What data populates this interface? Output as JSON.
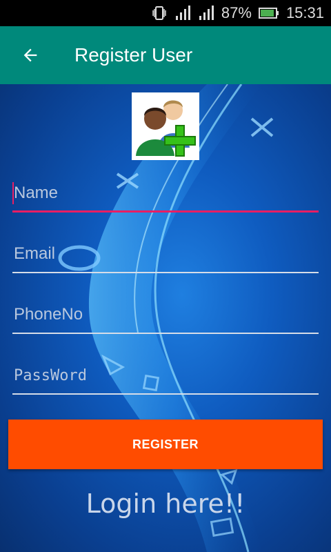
{
  "status_bar": {
    "battery_percent": "87%",
    "time": "15:31",
    "icons": [
      "vibrate-icon",
      "signal-icon",
      "signal-icon",
      "battery-icon"
    ]
  },
  "app_bar": {
    "title": "Register User",
    "back_icon": "arrow-left-icon"
  },
  "form": {
    "avatar_icon": "add-user-icon",
    "name": {
      "placeholder": "Name",
      "value": ""
    },
    "email": {
      "placeholder": "Email",
      "value": ""
    },
    "phone": {
      "placeholder": "PhoneNo",
      "value": ""
    },
    "password": {
      "placeholder": "PassWord",
      "value": ""
    },
    "register_label": "REGISTER",
    "login_link": "Login here!!"
  },
  "colors": {
    "app_bar": "#00897b",
    "accent": "#e91e63",
    "button": "#ff4c00",
    "status_bar": "#000000"
  }
}
